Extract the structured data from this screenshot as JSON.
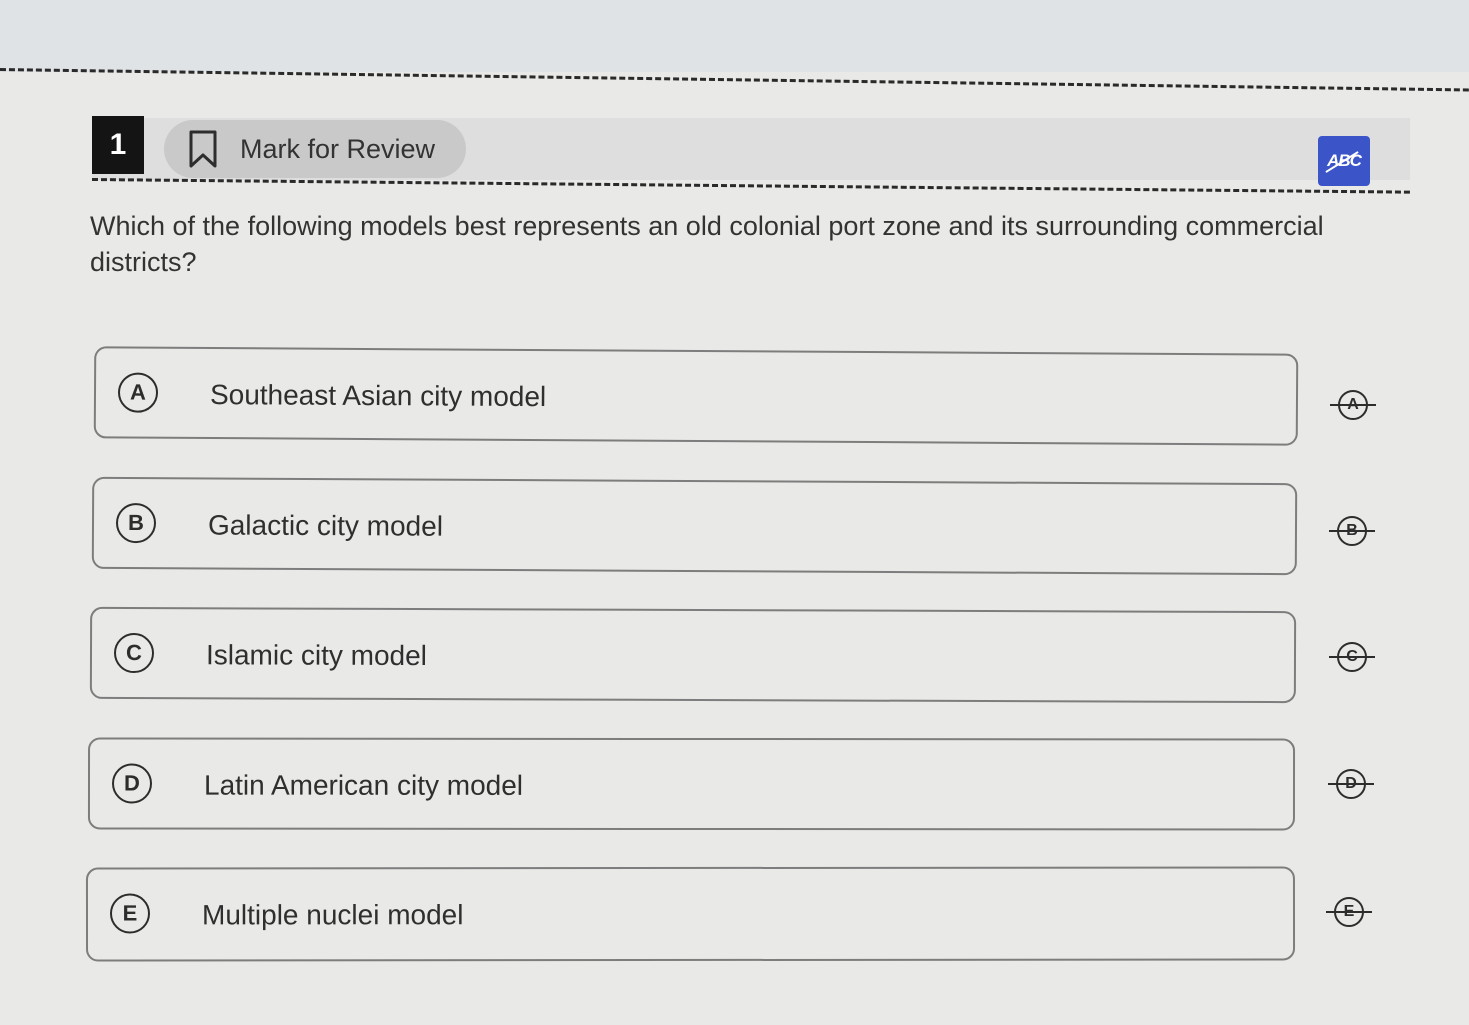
{
  "header": {
    "question_number": "1",
    "mark_for_review_label": "Mark for Review",
    "abc_tool_label": "ABC"
  },
  "question": {
    "text": "Which of the following models best represents an old colonial port zone and its surrounding commercial districts?"
  },
  "options": [
    {
      "letter": "A",
      "text": "Southeast Asian city model"
    },
    {
      "letter": "B",
      "text": "Galactic city model"
    },
    {
      "letter": "C",
      "text": "Islamic city model"
    },
    {
      "letter": "D",
      "text": "Latin American city model"
    },
    {
      "letter": "E",
      "text": "Multiple nuclei model"
    }
  ],
  "colors": {
    "background": "#e9e9e7",
    "accent": "#3b55c9",
    "question_number_bg": "#141414"
  },
  "icons": {
    "mark_for_review": "bookmark-icon",
    "abc_tool": "strikethrough-abc-icon",
    "eliminate": "eliminate-option-icon"
  }
}
